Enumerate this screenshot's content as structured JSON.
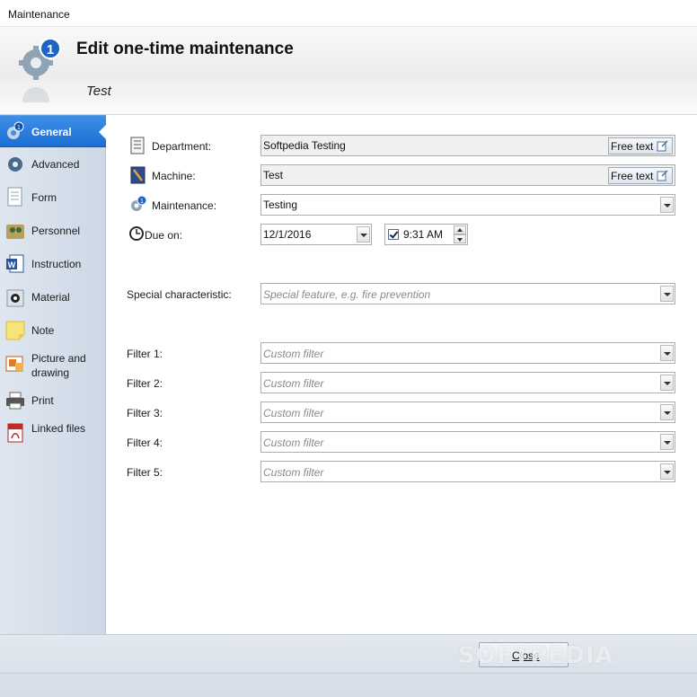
{
  "window": {
    "title": "Maintenance"
  },
  "header": {
    "title": "Edit one-time maintenance",
    "subtitle": "Test"
  },
  "sidebar": {
    "items": [
      {
        "label": "General",
        "icon": "gear-badge-icon"
      },
      {
        "label": "Advanced",
        "icon": "advanced-gear-icon"
      },
      {
        "label": "Form",
        "icon": "form-icon"
      },
      {
        "label": "Personnel",
        "icon": "personnel-icon"
      },
      {
        "label": "Instruction",
        "icon": "word-document-icon"
      },
      {
        "label": "Material",
        "icon": "material-icon"
      },
      {
        "label": "Note",
        "icon": "note-icon"
      },
      {
        "label": "Picture and drawing",
        "icon": "picture-icon"
      },
      {
        "label": "Print",
        "icon": "printer-icon"
      },
      {
        "label": "Linked files",
        "icon": "pdf-icon"
      }
    ],
    "active_index": 0
  },
  "form": {
    "department": {
      "label": "Department:",
      "value": "Softpedia Testing",
      "button": "Free text"
    },
    "machine": {
      "label": "Machine:",
      "value": "Test",
      "button": "Free text"
    },
    "maintenance": {
      "label": "Maintenance:",
      "value": "Testing"
    },
    "due_on": {
      "label": "Due on:",
      "date": "12/1/2016",
      "time": "9:31 AM",
      "time_enabled": true
    },
    "special": {
      "label": "Special characteristic:",
      "placeholder": "Special feature, e.g. fire prevention"
    },
    "filters": [
      {
        "label": "Filter 1:",
        "placeholder": "Custom filter"
      },
      {
        "label": "Filter 2:",
        "placeholder": "Custom filter"
      },
      {
        "label": "Filter 3:",
        "placeholder": "Custom filter"
      },
      {
        "label": "Filter 4:",
        "placeholder": "Custom filter"
      },
      {
        "label": "Filter 5:",
        "placeholder": "Custom filter"
      }
    ]
  },
  "footer": {
    "close_label": "Close",
    "watermark": "SOFTPEDIA"
  },
  "colors": {
    "accent": "#1b6fd4",
    "sidebar": "#d6dfea"
  }
}
